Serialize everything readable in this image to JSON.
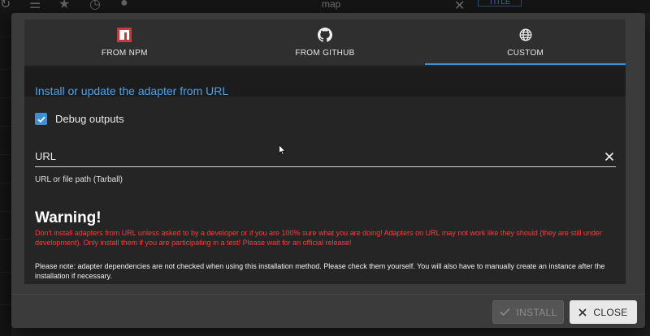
{
  "background": {
    "search_text": "map",
    "title_badge": "TITLE"
  },
  "dialog": {
    "tabs": [
      {
        "label": "FROM NPM",
        "icon": "npm-icon",
        "active": false
      },
      {
        "label": "FROM GITHUB",
        "icon": "github-icon",
        "active": false
      },
      {
        "label": "CUSTOM",
        "icon": "globe-icon",
        "active": true
      }
    ],
    "header_title": "Install or update the adapter from URL",
    "debug_checkbox": {
      "label": "Debug outputs",
      "checked": true
    },
    "url_field": {
      "placeholder": "URL",
      "value": "",
      "helper_text": "URL or file path (Tarball)"
    },
    "warning": {
      "title": "Warning!",
      "text": "Don't install adapters from URL unless asked to by a developer or if you are 100% sure what you are doing! Adapters on URL may not work like they should (they are still under development). Only install them if you are participating in a test! Please wait for an official release!"
    },
    "note_text": "Please note: adapter dependencies are not checked when using this installation method. Please check them yourself. You will also have to manually create an instance after the installation if necessary.",
    "buttons": {
      "install_label": "INSTALL",
      "close_label": "CLOSE"
    }
  },
  "colors": {
    "accent": "#3d8fd6",
    "header_title": "#4aa3ea",
    "warning_text": "#ff3a3a",
    "npm_red": "#cb3837"
  }
}
